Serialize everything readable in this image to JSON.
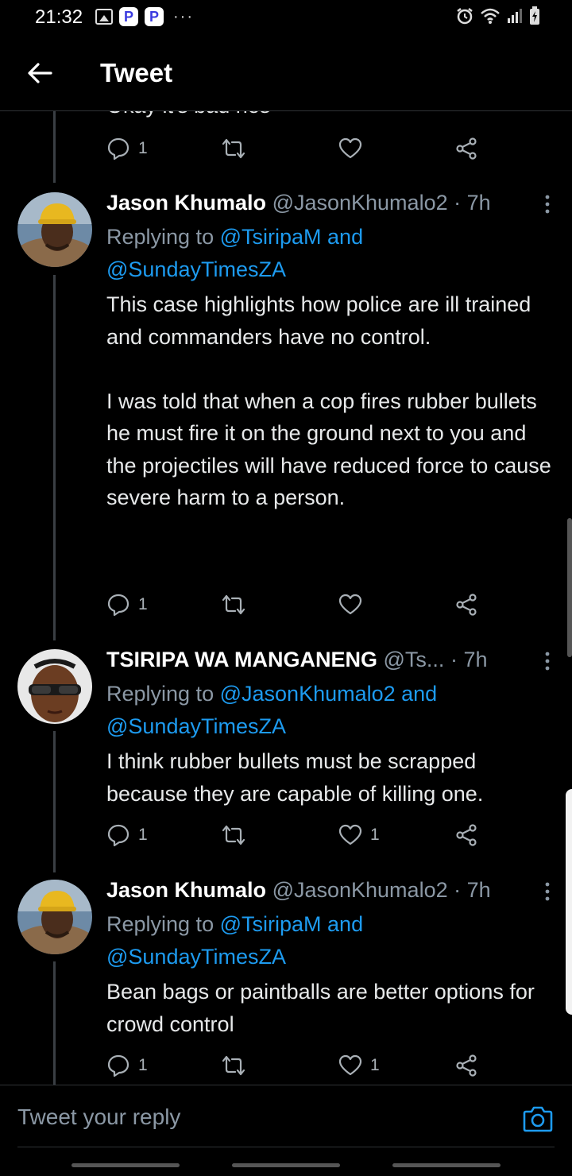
{
  "status_bar": {
    "time": "21:32",
    "left_icons": [
      "image-icon",
      "p-app-icon",
      "p-app-icon",
      "more-dots-icon"
    ],
    "right_icons": [
      "alarm-icon",
      "wifi-icon",
      "signal-icon",
      "battery-icon"
    ],
    "p_label": "P",
    "dots": "···"
  },
  "header": {
    "title": "Tweet",
    "back_icon": "arrow-left-icon"
  },
  "partial_tweet": {
    "visible_fragment": "Okay it's bad nes",
    "replies": "1",
    "retweets": "",
    "likes": ""
  },
  "tweets": [
    {
      "name": "Jason Khumalo",
      "handle": "@JasonKhumalo2",
      "separator": "·",
      "time": "7h",
      "replying_prefix": "Replying to",
      "replying_to_1": "@TsiripaM and",
      "replying_to_2": "@SundayTimesZA",
      "body": "This case highlights how police are ill trained and commanders have no control.\n\nI was told that when a cop fires rubber bullets he must fire it on the ground next to you and the projectiles will have reduced force to cause severe harm to a person.",
      "replies": "1",
      "retweets": "",
      "likes": ""
    },
    {
      "name": "TSIRIPA WA MANGANENG",
      "handle": "@Ts...",
      "separator": "·",
      "time": "7h",
      "replying_prefix": "Replying to",
      "replying_to_1": "@JasonKhumalo2 and",
      "replying_to_2": "@SundayTimesZA",
      "body": "I think rubber bullets must be scrapped because they are capable of killing one.",
      "replies": "1",
      "retweets": "",
      "likes": "1"
    },
    {
      "name": "Jason Khumalo",
      "handle": "@JasonKhumalo2",
      "separator": "·",
      "time": "7h",
      "replying_prefix": "Replying to",
      "replying_to_1": "@TsiripaM and",
      "replying_to_2": "@SundayTimesZA",
      "body": "Bean bags or paintballs are better options for crowd control",
      "replies": "1",
      "retweets": "",
      "likes": "1"
    }
  ],
  "reply_bar": {
    "placeholder": "Tweet your reply",
    "camera_icon": "camera-icon"
  },
  "colors": {
    "background": "#000000",
    "accent": "#1d9bf0",
    "secondary_text": "#8b98a5",
    "icon_gray": "#a9b0b6"
  }
}
